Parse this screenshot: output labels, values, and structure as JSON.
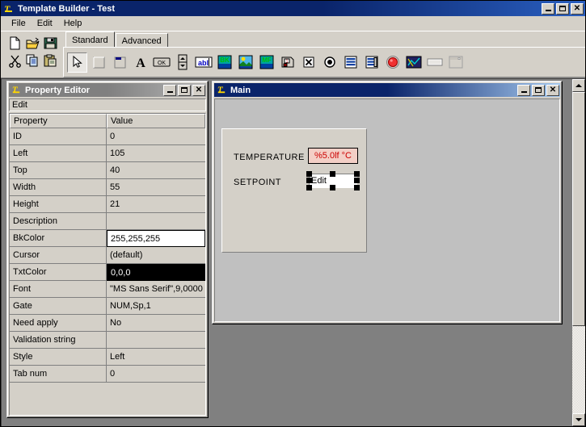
{
  "app": {
    "title": "Template Builder - Test",
    "icon": "template-builder-icon",
    "window_buttons": {
      "minimize": "_",
      "maximize": "□",
      "close": "✕"
    }
  },
  "menu": {
    "items": [
      {
        "label": "File"
      },
      {
        "label": "Edit"
      },
      {
        "label": "Help"
      }
    ]
  },
  "toolbar": {
    "file_tools": [
      {
        "name": "new-file-icon",
        "tip": "New"
      },
      {
        "name": "open-folder-icon",
        "tip": "Open"
      },
      {
        "name": "save-disk-icon",
        "tip": "Save"
      },
      {
        "name": "cut-scissors-icon",
        "tip": "Cut"
      },
      {
        "name": "copy-icon",
        "tip": "Copy"
      },
      {
        "name": "paste-clipboard-icon",
        "tip": "Paste"
      }
    ],
    "tabs": [
      {
        "label": "Standard",
        "active": true
      },
      {
        "label": "Advanced",
        "active": false
      }
    ],
    "controls": [
      {
        "name": "pointer-arrow-icon",
        "label": "Select",
        "pressed": true
      },
      {
        "name": "panel-icon",
        "label": "Panel"
      },
      {
        "name": "groupbox-icon",
        "label": "Group Box"
      },
      {
        "name": "text-label-icon",
        "label": "A"
      },
      {
        "name": "ok-button-icon",
        "label": "OK"
      },
      {
        "name": "spin-updown-icon",
        "label": "Spinner"
      },
      {
        "name": "edit-box-icon",
        "label": "abl"
      },
      {
        "name": "bitmap-bk-icon",
        "label": "BK"
      },
      {
        "name": "picture-icon",
        "label": "Picture"
      },
      {
        "name": "metafile-icon",
        "label": "MF"
      },
      {
        "name": "device-icon",
        "label": "Device"
      },
      {
        "name": "checkbox-icon",
        "label": "Check Box"
      },
      {
        "name": "radio-button-icon",
        "label": "Radio Button"
      },
      {
        "name": "list-box-icon",
        "label": "List Box"
      },
      {
        "name": "combo-box-icon",
        "label": "Combo Box"
      },
      {
        "name": "led-indicator-icon",
        "label": "LED"
      },
      {
        "name": "chart-icon",
        "label": "Chart"
      },
      {
        "name": "progress-bar-icon",
        "label": "Progress Bar"
      },
      {
        "name": "window-frame-icon",
        "label": "Window"
      }
    ]
  },
  "property_editor": {
    "title": "Property Editor",
    "icon": "template-builder-icon",
    "active": false,
    "window_buttons": {
      "minimize": "_",
      "maximize": "□",
      "close": "✕"
    },
    "selected_object": "Edit",
    "columns": {
      "property": "Property",
      "value": "Value"
    },
    "rows": [
      {
        "property": "ID",
        "value": "0",
        "state": "normal"
      },
      {
        "property": "Left",
        "value": "105",
        "state": "normal"
      },
      {
        "property": "Top",
        "value": "40",
        "state": "normal"
      },
      {
        "property": "Width",
        "value": "55",
        "state": "normal"
      },
      {
        "property": "Height",
        "value": "21",
        "state": "normal"
      },
      {
        "property": "Description",
        "value": "",
        "state": "normal"
      },
      {
        "property": "BkColor",
        "value": "255,255,255",
        "state": "editing-white"
      },
      {
        "property": "Cursor",
        "value": "(default)",
        "state": "normal"
      },
      {
        "property": "TxtColor",
        "value": "0,0,0",
        "state": "editing-black"
      },
      {
        "property": "Font",
        "value": "\"MS Sans Serif\",9,0000",
        "state": "normal"
      },
      {
        "property": "Gate",
        "value": "NUM,Sp,1",
        "state": "normal"
      },
      {
        "property": "Need apply",
        "value": "No",
        "state": "normal"
      },
      {
        "property": "Validation string",
        "value": "",
        "state": "normal"
      },
      {
        "property": "Style",
        "value": "Left",
        "state": "normal"
      },
      {
        "property": "Tab num",
        "value": "0",
        "state": "normal"
      }
    ]
  },
  "main_window": {
    "title": "Main",
    "icon": "template-builder-icon",
    "active": true,
    "window_buttons": {
      "minimize": "_",
      "maximize": "□",
      "close": "✕"
    },
    "form": {
      "labels": [
        {
          "name": "temperature",
          "text": "TEMPERATURE"
        },
        {
          "name": "setpoint",
          "text": "SETPOINT"
        }
      ],
      "temperature_field": {
        "text": "%5.0lf °C",
        "text_color": "#cc0000",
        "bg_color": "#f3cfc6"
      },
      "setpoint_edit": {
        "text": "Edit",
        "selected": true,
        "bg_color": "#ffffff"
      }
    }
  },
  "colors": {
    "window_face": "#d4d0c8",
    "mdi_background": "#808080",
    "active_title": "#0a246a",
    "inactive_title": "#808080",
    "form_face": "#d4d0c8",
    "design_surface": "#c0c0c0"
  }
}
